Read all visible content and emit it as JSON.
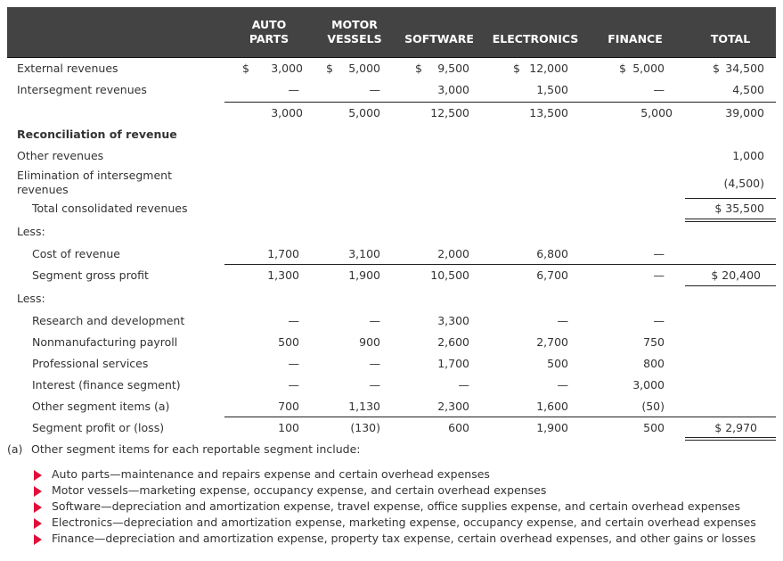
{
  "columns": [
    {
      "key": "auto_parts",
      "line1": "AUTO",
      "line2": "PARTS"
    },
    {
      "key": "motor_vessels",
      "line1": "MOTOR",
      "line2": "VESSELS"
    },
    {
      "key": "software",
      "line1": "",
      "line2": "SOFTWARE"
    },
    {
      "key": "electronics",
      "line1": "",
      "line2": "ELECTRONICS"
    },
    {
      "key": "finance",
      "line1": "",
      "line2": "FINANCE"
    },
    {
      "key": "total",
      "line1": "",
      "line2": "TOTAL"
    }
  ],
  "rows": {
    "external_revenues": {
      "label": "External revenues",
      "values": [
        "3,000",
        "5,000",
        "9,500",
        "12,000",
        "5,000",
        "34,500"
      ],
      "dollar": "$"
    },
    "intersegment_revenues": {
      "label": "Intersegment revenues",
      "values": [
        "—",
        "—",
        "3,000",
        "1,500",
        "—",
        "4,500"
      ]
    },
    "revenue_subtotal": {
      "label": "",
      "values": [
        "3,000",
        "5,000",
        "12,500",
        "13,500",
        "5,000",
        "39,000"
      ]
    },
    "reconciliation_heading": {
      "label": "Reconciliation of revenue"
    },
    "other_revenues": {
      "label": "Other revenues",
      "total": "1,000"
    },
    "elimination": {
      "label_line1": "Elimination of intersegment",
      "label_line2": "revenues",
      "total": "(4,500)"
    },
    "total_consolidated": {
      "label": "Total consolidated revenues",
      "total": "$ 35,500"
    },
    "less_1": {
      "label": "Less:"
    },
    "cost_of_revenue": {
      "label": "Cost of revenue",
      "values": [
        "1,700",
        "3,100",
        "2,000",
        "6,800",
        "—"
      ]
    },
    "segment_gross_profit": {
      "label": "Segment gross profit",
      "values": [
        "1,300",
        "1,900",
        "10,500",
        "6,700",
        "—"
      ],
      "total": "$ 20,400"
    },
    "less_2": {
      "label": "Less:"
    },
    "research_development": {
      "label": "Research and development",
      "values": [
        "—",
        "—",
        "3,300",
        "—",
        "—"
      ]
    },
    "nonmanufacturing_payroll": {
      "label": "Nonmanufacturing payroll",
      "values": [
        "500",
        "900",
        "2,600",
        "2,700",
        "750"
      ]
    },
    "professional_services": {
      "label": "Professional services",
      "values": [
        "—",
        "—",
        "1,700",
        "500",
        "800"
      ]
    },
    "interest_finance": {
      "label": "Interest (finance segment)",
      "values": [
        "—",
        "—",
        "—",
        "—",
        "3,000"
      ]
    },
    "other_segment_items": {
      "label": "Other segment items (a)",
      "values": [
        "700",
        "1,130",
        "2,300",
        "1,600",
        "(50)"
      ]
    },
    "segment_profit_loss": {
      "label": "Segment profit or (loss)",
      "values": [
        "100",
        "(130)",
        "600",
        "1,900",
        "500"
      ],
      "total": "$ 2,970"
    }
  },
  "footnote": {
    "marker": "(a)",
    "text": "Other segment items for each reportable segment include:",
    "items": [
      "Auto parts—maintenance and repairs expense and certain overhead expenses",
      "Motor vessels—marketing expense, occupancy expense, and certain overhead expenses",
      "Software—depreciation and amortization expense, travel expense, office supplies expense, and certain overhead expenses",
      "Electronics—depreciation and amortization expense, marketing expense, occupancy expense, and certain overhead expenses",
      "Finance—depreciation and amortization expense, property tax expense, certain overhead expenses, and other gains or losses"
    ]
  },
  "colors": {
    "header_bg": "#434343",
    "bullet": "#e0103a",
    "text": "#333333"
  }
}
